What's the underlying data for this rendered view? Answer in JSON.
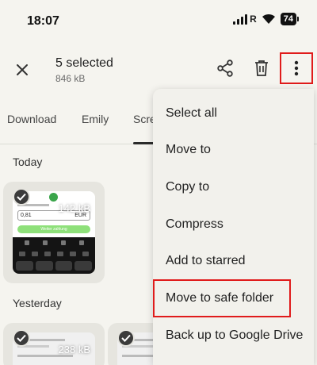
{
  "status": {
    "time": "18:07",
    "carrier_r": "R",
    "battery": "74"
  },
  "header": {
    "title": "5 selected",
    "subtitle": "846 kB"
  },
  "icons": {
    "close": "close-icon",
    "share": "share-icon",
    "delete": "trash-icon",
    "more": "more-vert-icon"
  },
  "tabs": [
    {
      "label": "Download"
    },
    {
      "label": "Emily"
    },
    {
      "label": "Scre"
    }
  ],
  "sections": {
    "today": "Today",
    "yesterday": "Yesterday"
  },
  "thumbnails": {
    "today": [
      {
        "size": "142 kB",
        "amount": "0,81",
        "currency": "EUR",
        "button": "Weiter zahlung"
      }
    ],
    "yesterday": [
      {
        "size": "238 kB"
      },
      {
        "size": ""
      }
    ]
  },
  "menu": {
    "items": [
      {
        "label": "Select all"
      },
      {
        "label": "Move to"
      },
      {
        "label": "Copy to"
      },
      {
        "label": "Compress"
      },
      {
        "label": "Add to starred"
      },
      {
        "label": "Move to safe folder"
      },
      {
        "label": "Back up to Google Drive"
      }
    ]
  },
  "colors": {
    "background": "#f5f4ef",
    "highlight": "#e01b1b",
    "thumbnail_green": "#8ee07a"
  }
}
